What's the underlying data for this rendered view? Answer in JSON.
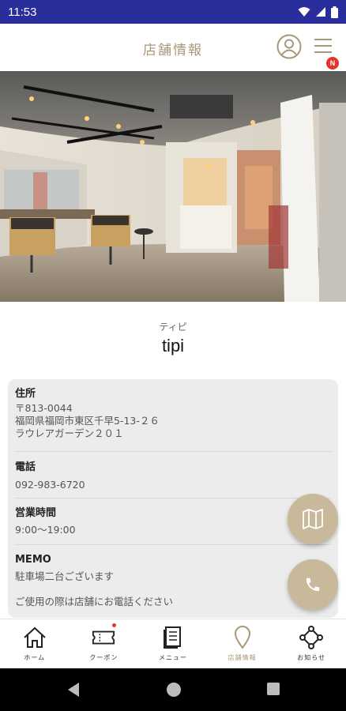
{
  "status_bar": {
    "time": "11:53",
    "icons": [
      "wifi-icon",
      "signal-icon",
      "battery-icon"
    ]
  },
  "header": {
    "title": "店舗情報",
    "profile_icon": "user-circle-icon",
    "menu_icon": "hamburger-menu-icon",
    "menu_badge": "N"
  },
  "hero": {
    "image": "salon-interior-photo"
  },
  "shop": {
    "kana": "ティピ",
    "name": "tipi"
  },
  "info": {
    "address": {
      "label": "住所",
      "postal": "〒813-0044",
      "line1": "福岡県福岡市東区千早5-13-２６",
      "line2": "ラウレアガーデン２０１"
    },
    "phone": {
      "label": "電話",
      "value": "092-983-6720"
    },
    "hours": {
      "label": "営業時間",
      "value": "9:00～19:00"
    },
    "memo": {
      "label": "MEMO",
      "line1": "駐車場二台ございます",
      "line2": "ご使用の際は店舗にお電話ください"
    }
  },
  "fabs": {
    "map_icon": "map-icon",
    "phone_icon": "phone-icon"
  },
  "bottom_nav": {
    "items": [
      {
        "label": "ホーム",
        "icon": "home-icon"
      },
      {
        "label": "クーポン",
        "icon": "ticket-icon"
      },
      {
        "label": "メニュー",
        "icon": "book-icon"
      },
      {
        "label": "店舗情報",
        "icon": "location-pin-icon"
      },
      {
        "label": "お知らせ",
        "icon": "network-icon"
      }
    ]
  },
  "colors": {
    "status_bar": "#2a2e9c",
    "accent": "#c8b99a",
    "title_gold": "#a89878",
    "badge_red": "#e3342f",
    "card_bg": "#ececec"
  }
}
